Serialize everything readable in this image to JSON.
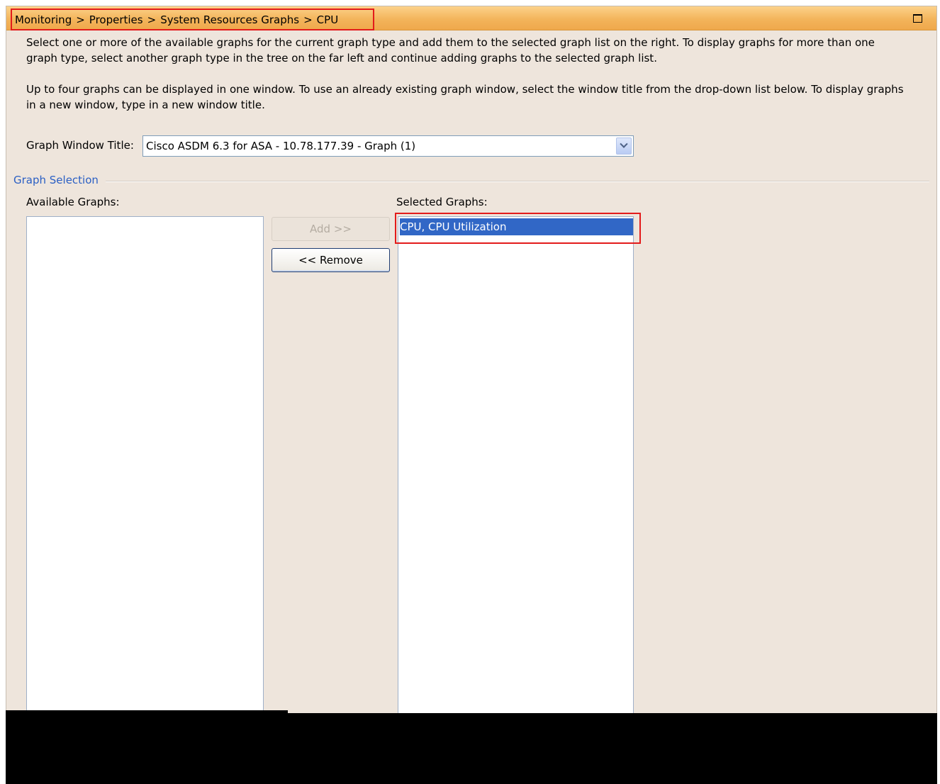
{
  "window": {
    "breadcrumb": [
      "Monitoring",
      "Properties",
      "System Resources Graphs",
      "CPU"
    ],
    "breadcrumb_separator": ">",
    "maximize_icon": "maximize-icon"
  },
  "description": {
    "paragraph1": "Select one or more of the available graphs for the current graph type and add them to the selected graph list on the right. To display graphs for more than one graph type, select another graph type in the tree on the far left and continue adding graphs to the selected graph list.",
    "paragraph2": "Up to four graphs can be displayed in one window. To use an already existing graph window, select the window title from the drop-down list below. To display graphs in a new window, type in a new window title."
  },
  "graph_window_title": {
    "label": "Graph Window Title:",
    "value": "Cisco ASDM 6.3 for ASA - 10.78.177.39 - Graph (1)"
  },
  "graph_selection": {
    "group_title": "Graph Selection",
    "available_label": "Available Graphs:",
    "available_items": [],
    "selected_label": "Selected Graphs:",
    "selected_items": [
      "CPU, CPU Utilization"
    ],
    "add_button": "Add >>",
    "remove_button": "<< Remove"
  },
  "colors": {
    "title_bar": "#f3b45b",
    "selection": "#3167c6",
    "annotation_box": "#e31b1b",
    "group_title": "#2a5fc4"
  }
}
